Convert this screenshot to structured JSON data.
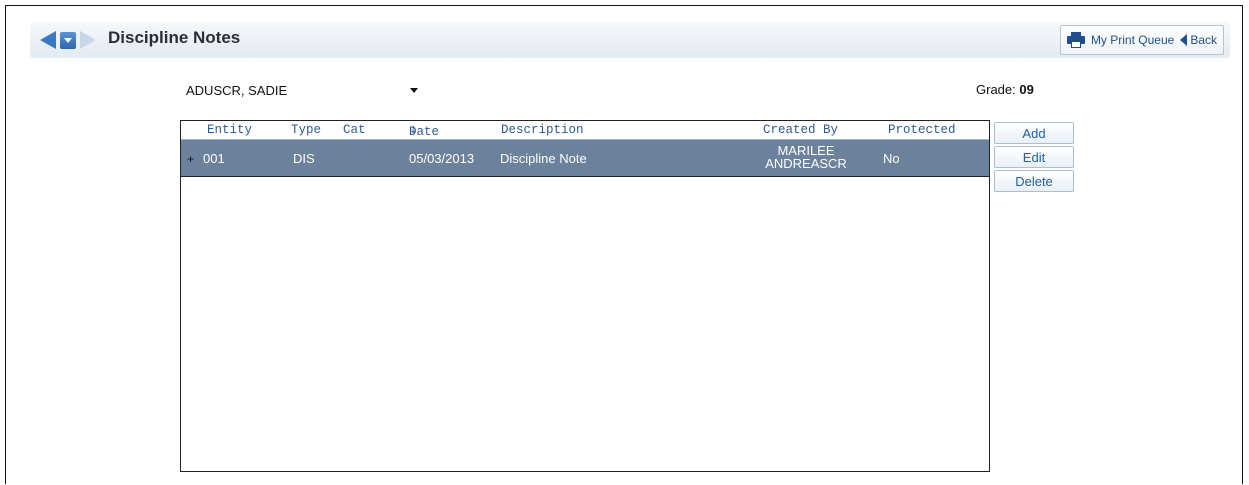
{
  "header": {
    "title": "Discipline Notes",
    "print_queue_label": "My Print Queue",
    "back_label": "Back"
  },
  "student_select": {
    "selected": "ADUSCR, SADIE"
  },
  "grade": {
    "label": "Grade:",
    "value": "09"
  },
  "table": {
    "columns": [
      "Entity",
      "Type",
      "Cat",
      "Date",
      "Description",
      "Created By",
      "Protected"
    ],
    "sort_indicator": "↓",
    "rows": [
      {
        "expander": "+",
        "entity": "001",
        "type": "DIS",
        "cat": "",
        "date": "05/03/2013",
        "description": "Discipline Note",
        "created_by_line1": "MARILEE",
        "created_by_line2": "ANDREASCR",
        "protected": "No"
      }
    ]
  },
  "actions": {
    "add": "Add",
    "edit": "Edit",
    "delete": "Delete"
  },
  "icons": {
    "back": "back-arrow-icon",
    "menu": "dropdown-icon",
    "forward": "forward-arrow-icon",
    "printer": "printer-icon",
    "back_link": "back-triangle-icon"
  },
  "colors": {
    "selected_row": "#6c819c",
    "accent": "#3b78c4",
    "header_text": "#2d5a94"
  }
}
